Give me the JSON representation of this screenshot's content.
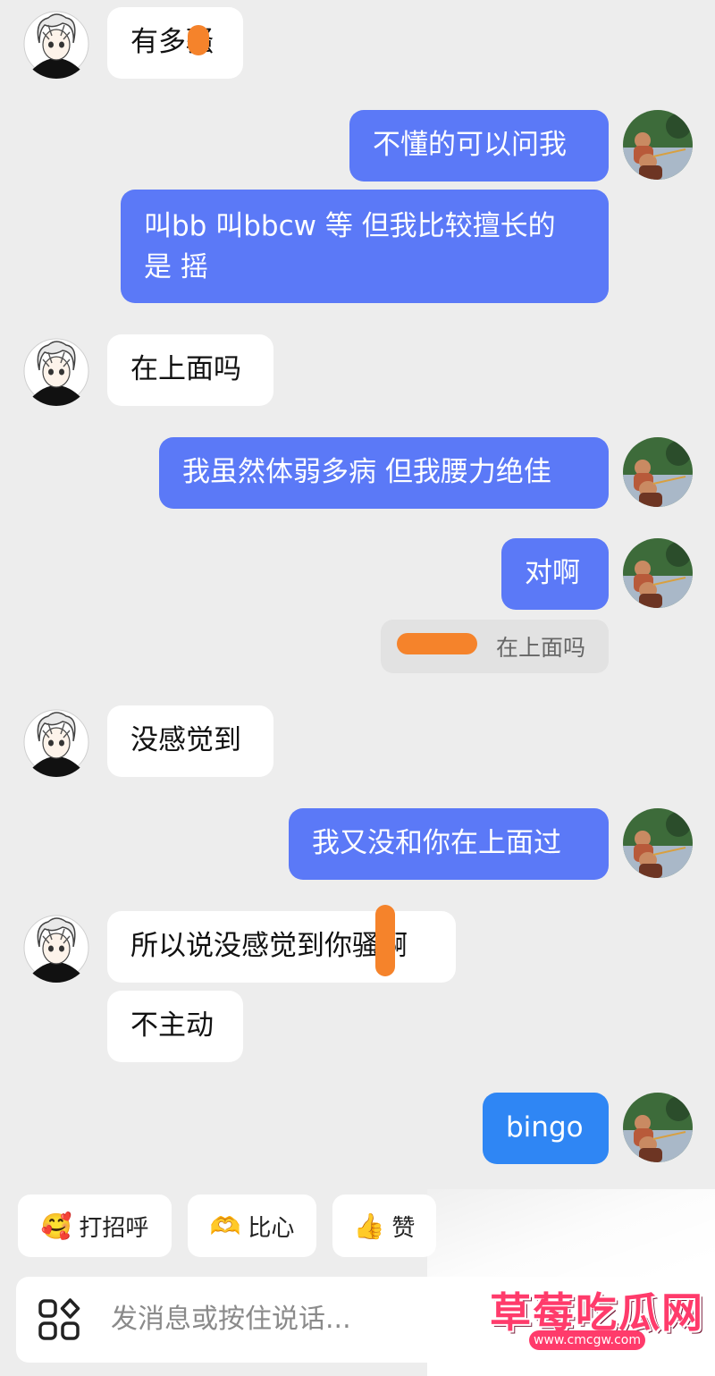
{
  "messages": [
    {
      "side": "in",
      "text": "有多骚"
    },
    {
      "side": "out",
      "text": "不懂的可以问我"
    },
    {
      "side": "out",
      "text": "叫bb 叫bbcw 等 但我比较擅长的\n是 摇"
    },
    {
      "side": "in",
      "text": "在上面吗"
    },
    {
      "side": "out",
      "text": "我虽然体弱多病 但我腰力绝佳"
    },
    {
      "side": "out",
      "text": "对啊"
    },
    {
      "side": "quote",
      "text": "在上面吗"
    },
    {
      "side": "in",
      "text": "没感觉到"
    },
    {
      "side": "out",
      "text": "我又没和你在上面过"
    },
    {
      "side": "in",
      "text": "所以说没感觉到你骚啊"
    },
    {
      "side": "in",
      "text": "不主动"
    },
    {
      "side": "out",
      "text": "bingo"
    }
  ],
  "quick_replies": [
    {
      "emoji": "🥰",
      "label": "打招呼"
    },
    {
      "emoji": "🫶",
      "label": "比心"
    },
    {
      "emoji": "👍",
      "label": "赞"
    }
  ],
  "input": {
    "placeholder": "发消息或按住说话..."
  },
  "watermark": {
    "title": "草莓吃瓜网",
    "url": "www.cmcgw.com"
  },
  "colors": {
    "out_bubble": "#5b79f7",
    "bingo_bubble": "#2f86f4",
    "in_bubble": "#ffffff",
    "background": "#ededed",
    "redaction": "#f5832b"
  },
  "icons": {
    "apps": "apps-grid-icon",
    "left_avatar": "anime-avatar-icon",
    "right_avatar": "photo-avatar-icon"
  }
}
